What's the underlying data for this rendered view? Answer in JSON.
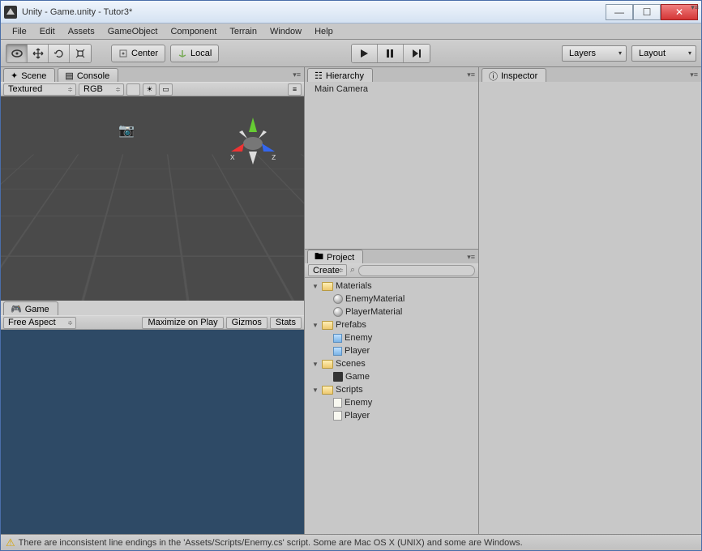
{
  "window": {
    "title": "Unity - Game.unity - Tutor3*"
  },
  "menu": [
    "File",
    "Edit",
    "Assets",
    "GameObject",
    "Component",
    "Terrain",
    "Window",
    "Help"
  ],
  "toolbar": {
    "center_label": "Center",
    "local_label": "Local",
    "layers_label": "Layers",
    "layout_label": "Layout"
  },
  "scene": {
    "tab_label": "Scene",
    "console_tab": "Console",
    "shading": "Textured",
    "render_mode": "RGB",
    "axis_x": "x",
    "axis_z": "z"
  },
  "game": {
    "tab_label": "Game",
    "aspect": "Free Aspect",
    "maximize": "Maximize on Play",
    "gizmos": "Gizmos",
    "stats": "Stats"
  },
  "hierarchy": {
    "tab_label": "Hierarchy",
    "items": [
      "Main Camera"
    ]
  },
  "project": {
    "tab_label": "Project",
    "create_label": "Create",
    "tree": [
      {
        "name": "Materials",
        "type": "folder",
        "open": true,
        "children": [
          {
            "name": "EnemyMaterial",
            "type": "material"
          },
          {
            "name": "PlayerMaterial",
            "type": "material"
          }
        ]
      },
      {
        "name": "Prefabs",
        "type": "folder",
        "open": true,
        "children": [
          {
            "name": "Enemy",
            "type": "prefab"
          },
          {
            "name": "Player",
            "type": "prefab"
          }
        ]
      },
      {
        "name": "Scenes",
        "type": "folder",
        "open": true,
        "children": [
          {
            "name": "Game",
            "type": "scene"
          }
        ]
      },
      {
        "name": "Scripts",
        "type": "folder",
        "open": true,
        "children": [
          {
            "name": "Enemy",
            "type": "script"
          },
          {
            "name": "Player",
            "type": "script"
          }
        ]
      }
    ]
  },
  "inspector": {
    "tab_label": "Inspector"
  },
  "status": {
    "message": "There are inconsistent line endings in the 'Assets/Scripts/Enemy.cs' script. Some are Mac OS X (UNIX) and some are Windows."
  }
}
